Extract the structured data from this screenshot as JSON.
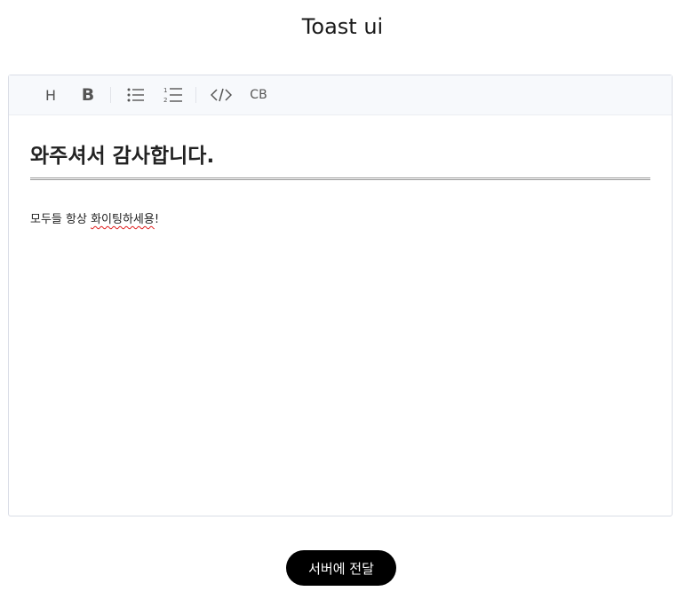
{
  "page": {
    "title": "Toast ui"
  },
  "toolbar": {
    "items": [
      {
        "icon": "heading-icon",
        "label": "H"
      },
      {
        "icon": "bold-icon",
        "label": "B"
      },
      {
        "icon": "bullet-list-icon"
      },
      {
        "icon": "ordered-list-icon"
      },
      {
        "icon": "code-icon"
      },
      {
        "icon": "codeblock-icon",
        "label": "CB"
      }
    ]
  },
  "editor": {
    "heading": "와주셔서 감사합니다.",
    "paragraph_plain": "모두들 항상 ",
    "paragraph_misspelled": "화이팅하세용",
    "paragraph_end": "!"
  },
  "actions": {
    "submit_label": "서버에 전달"
  },
  "colors": {
    "toolbar_bg": "#f7f9fc",
    "button_bg": "#000000",
    "spellcheck": "#e02020"
  }
}
